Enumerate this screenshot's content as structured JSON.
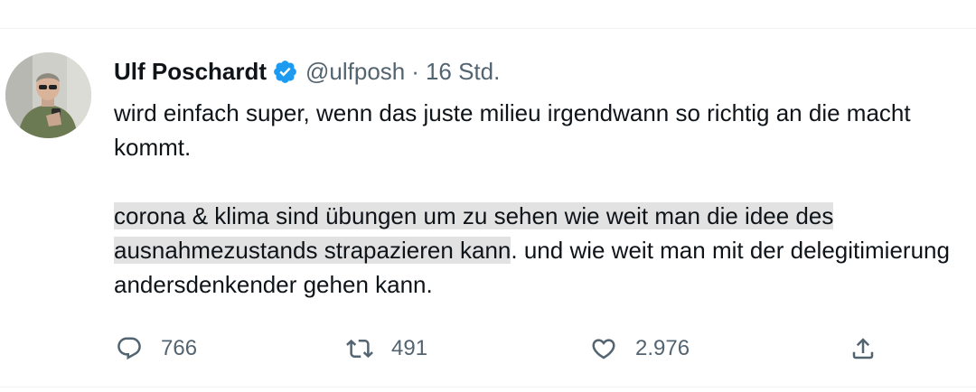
{
  "tweet": {
    "author_name": "Ulf Poschardt",
    "handle": "@ulfposh",
    "separator": "·",
    "time": "16 Std.",
    "para1": "wird einfach super, wenn das juste milieu irgendwann so richtig an die macht kommt.",
    "para2_highlight": "corona & klima sind übungen um zu sehen wie weit man die idee des ausnahmezustands strapazieren kann",
    "para2_rest": ". und wie weit man mit der delegitimierung andersdenkender gehen kann."
  },
  "actions": {
    "reply_count": "766",
    "retweet_count": "491",
    "like_count": "2.976"
  },
  "icons": {
    "verified": "verified-badge-icon",
    "reply": "reply-icon",
    "retweet": "retweet-icon",
    "like": "heart-icon",
    "share": "share-icon"
  },
  "colors": {
    "verified": "#1d9bf0",
    "muted": "#536471",
    "highlight": "#e2e2e2"
  }
}
